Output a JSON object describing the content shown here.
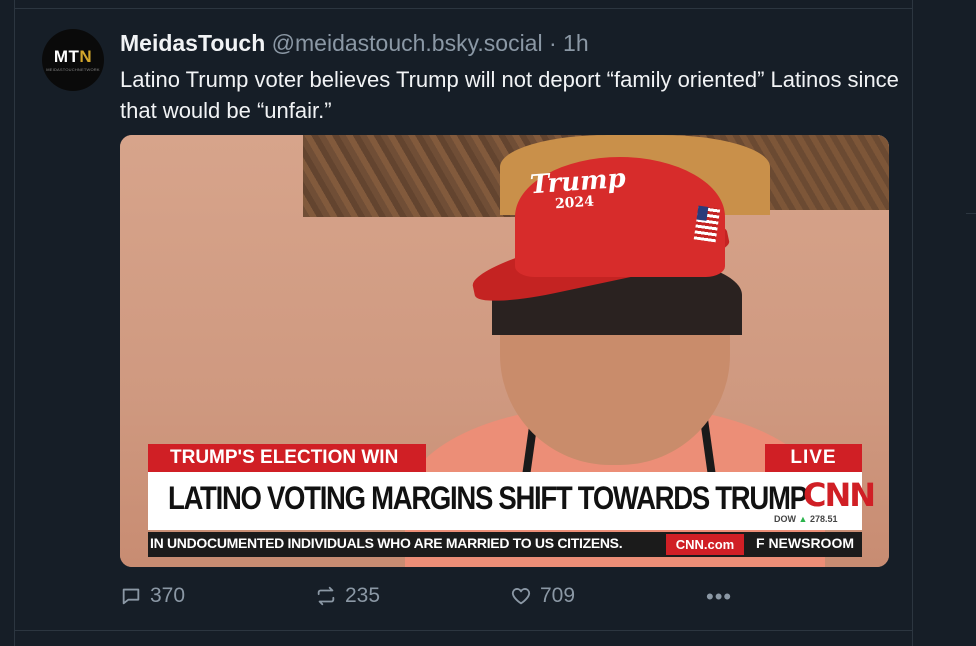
{
  "post": {
    "avatar_logo": "MTN",
    "avatar_subtext": "MEIDASTOUCHNETWORK",
    "author_name": "MeidasTouch",
    "handle": "@meidastouch.bsky.social",
    "separator": "·",
    "time": "1h",
    "text": "Latino Trump voter believes Trump will not deport “family oriented” Latinos since that would be “unfair.”"
  },
  "media": {
    "cap_text": "Trump",
    "cap_year": "2024",
    "section_label": "TRUMP'S ELECTION WIN",
    "live_label": "LIVE",
    "headline": "LATINO VOTING MARGINS SHIFT TOWARDS TRUMP",
    "network_logo": "CNN",
    "dow_label": "DOW",
    "dow_value": "278.51",
    "ticker_text": "IN UNDOCUMENTED INDIVIDUALS WHO ARE MARRIED TO US CITIZENS.",
    "ticker_brand": "CNN.com",
    "ticker_right": "F NEWSROOM"
  },
  "actions": {
    "replies": "370",
    "reposts": "235",
    "likes": "709",
    "more": "•••"
  },
  "colors": {
    "background": "#161e27",
    "text": "#f1f3f5",
    "muted": "#8b98a5",
    "cnn_red": "#d01f25"
  }
}
